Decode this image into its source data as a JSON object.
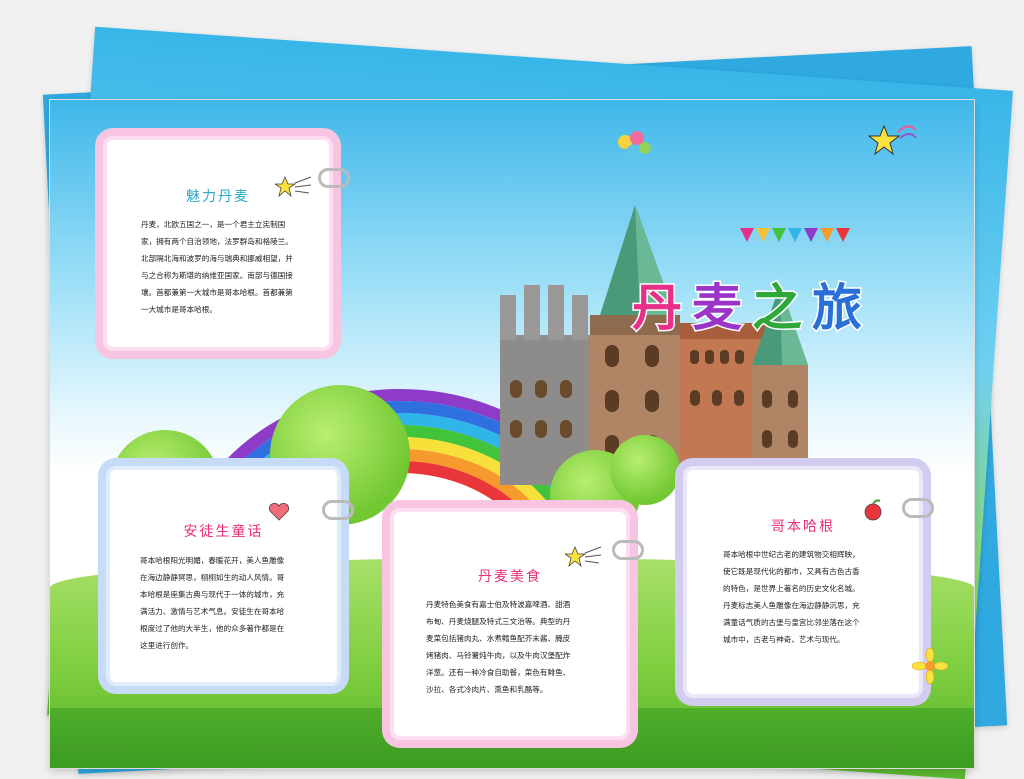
{
  "poster": {
    "title_chars": [
      "丹",
      "麦",
      "之",
      "旅"
    ],
    "title_colors": [
      "#e8308a",
      "#9b35c9",
      "#2fa83a",
      "#2a6fd8"
    ]
  },
  "cards": {
    "charm": {
      "title": "魅力丹麦",
      "title_color": "#2aa8c8",
      "lines": [
        "丹麦，北欧五国之一，是一个君主立宪制国",
        "家，拥有两个自治领地，法罗群岛和格陵兰。",
        "北部隔北海和波罗的海与瑞典和挪威相望，并",
        "与之合称为斯堪的纳维亚国家。南部与德国接",
        "壤。首都兼第一大城市是哥本哈根。首都兼第",
        "一大城市是哥本哈根。"
      ]
    },
    "andersen": {
      "title": "安徒生童话",
      "title_color": "#e8307a",
      "lines": [
        "哥本哈根阳光明媚，春暖花开，美人鱼雕像",
        "在海边静静冥思，栩栩如生的动人风情。哥",
        "本哈根是座集古典与现代于一体的城市，充",
        "满活力、激情与艺术气息。安徒生在哥本哈",
        "根度过了他的大半生，他的众多著作都是在",
        "这里进行创作。"
      ]
    },
    "food": {
      "title": "丹麦美食",
      "title_color": "#e8307a",
      "lines": [
        "丹麦特色美食有嘉士伯及特波嘉啤酒、甜酒",
        "布甸、丹麦烧腿及特式三文治等。典型的丹",
        "麦菜包括猪肉丸、水煮鳕鱼配芥末酱、腌皮",
        "烤猪肉、马铃薯炖牛肉，以及牛肉汉堡配炸",
        "洋葱。还有一种冷食自助餐，菜色有鲱鱼、",
        "沙拉、各式冷肉片、熏鱼和乳酪等。"
      ]
    },
    "copenhagen": {
      "title": "哥本哈根",
      "title_color": "#e8307a",
      "lines": [
        "哥本哈根中世纪古老的建筑物交相辉映，",
        "使它既是现代化的都市，又具有古色古香",
        "的特色，是世界上著名的历史文化名城。",
        "丹麦标志美人鱼雕像在海边静静沉思，充",
        "满童话气质的古堡与皇宫比邻坐落在这个",
        "城市中，古老与神奇、艺术与现代。"
      ]
    }
  }
}
